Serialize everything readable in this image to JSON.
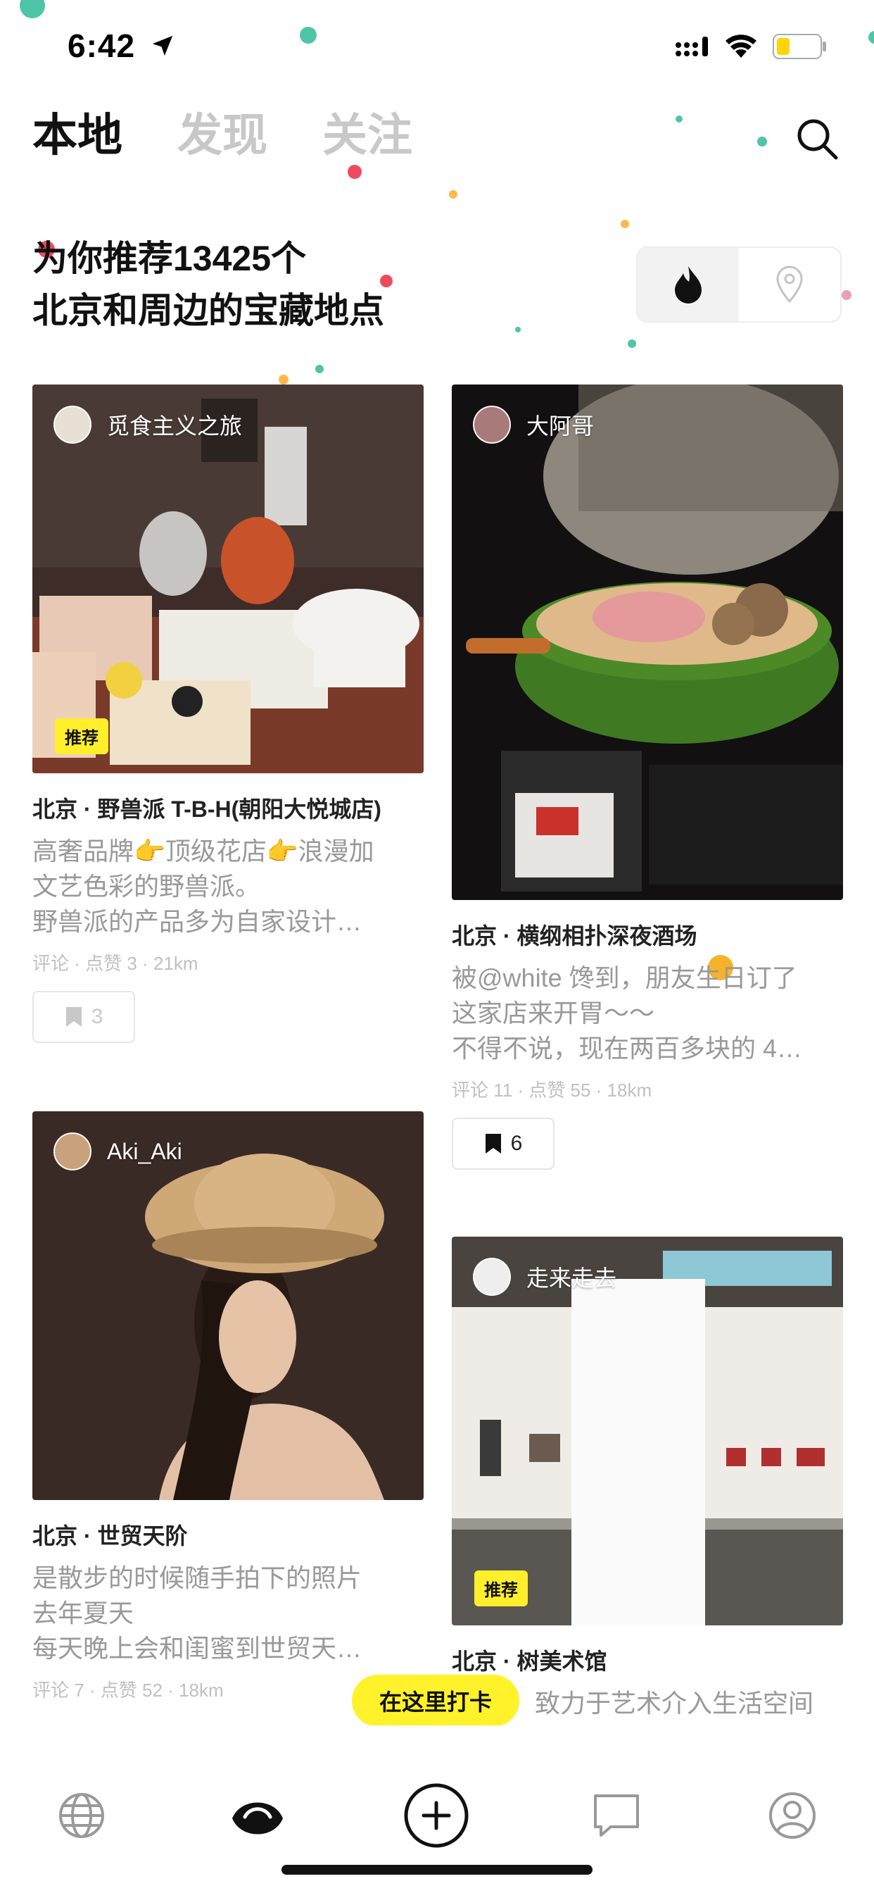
{
  "status_bar": {
    "time": "6:42"
  },
  "top_tabs": [
    {
      "label": "本地",
      "active": true
    },
    {
      "label": "发现",
      "active": false
    },
    {
      "label": "关注",
      "active": false
    }
  ],
  "headline": {
    "line1": "为你推荐13425个",
    "line2": "北京和周边的宝藏地点"
  },
  "mode_toggle": {
    "options": [
      "hot-icon",
      "location-pin-icon"
    ],
    "selected": "hot-icon"
  },
  "cards": [
    {
      "author": "觅食主义之旅",
      "tag": "推荐",
      "title": "北京 · 野兽派 T-B-H(朝阳大悦城店)",
      "desc": [
        "高奢品牌👉顶级花店👉浪漫加",
        "文艺色彩的野兽派。",
        "野兽派的产品多为自家设计…"
      ],
      "meta": "评论 · 点赞 3 · 21km",
      "saves": "3"
    },
    {
      "author": "大阿哥",
      "title": "北京 · 横纲相扑深夜酒场",
      "desc": [
        "被@white 馋到，朋友生日订了",
        "这家店来开胃～～",
        "不得不说，现在两百多块的 4…"
      ],
      "meta": "评论 11 · 点赞 55 · 18km",
      "saves": "6"
    },
    {
      "author": "Aki_Aki",
      "title": "北京 · 世贸天阶",
      "desc": [
        "是散步的时候随手拍下的照片",
        "去年夏天",
        "每天晚上会和闺蜜到世贸天…"
      ],
      "meta": "评论 7 · 点赞 52 · 18km"
    },
    {
      "author": "走来走去",
      "tag": "推荐",
      "title": "北京 · 树美术馆",
      "desc": [
        "致力于艺术介入生活空间"
      ]
    }
  ],
  "checkin_tip": "在这里打卡",
  "bottom_nav": [
    "globe-icon",
    "eye-icon",
    "add-icon",
    "message-icon",
    "profile-icon"
  ],
  "colors": {
    "accent": "#fff22a",
    "tag": "#ffef2b",
    "muted_text": "#999999"
  }
}
